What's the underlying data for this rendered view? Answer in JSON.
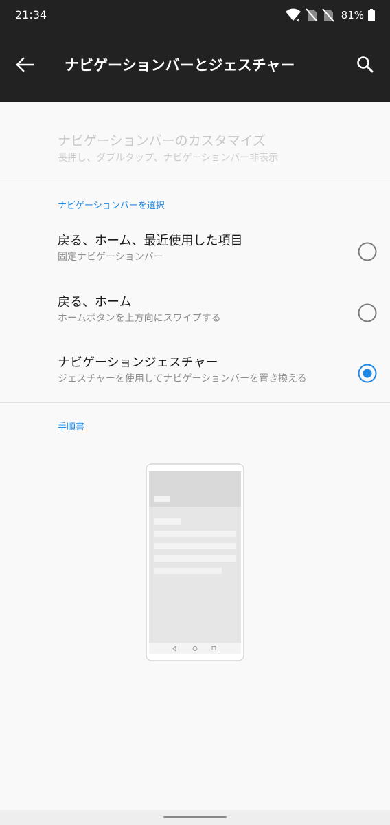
{
  "status_bar": {
    "time": "21:34",
    "battery_percent": "81%",
    "icons": [
      "wifi-icon",
      "no-sim-icon",
      "no-sim-icon",
      "battery-icon"
    ]
  },
  "app_bar": {
    "title": "ナビゲーションバーとジェスチャー",
    "back_icon": "arrow-left-icon",
    "search_icon": "search-icon"
  },
  "customize": {
    "title": "ナビゲーションバーのカスタマイズ",
    "subtitle": "長押し、ダブルタップ、ナビゲーションバー非表示",
    "enabled": false
  },
  "navbar_section": {
    "header": "ナビゲーションバーを選択",
    "options": [
      {
        "title": "戻る、ホーム、最近使用した項目",
        "subtitle": "固定ナビゲーションバー",
        "selected": false
      },
      {
        "title": "戻る、ホーム",
        "subtitle": "ホームボタンを上方向にスワイプする",
        "selected": false
      },
      {
        "title": "ナビゲーションジェスチャー",
        "subtitle": "ジェスチャーを使用してナビゲーションバーを置き換える",
        "selected": true
      }
    ]
  },
  "instructions_section": {
    "header": "手順書"
  },
  "colors": {
    "app_bar_bg": "#222222",
    "accent": "#1e88e5",
    "background": "#f9f9f9",
    "disabled_text": "#c8c8c8",
    "primary_text": "#1b1b1b",
    "secondary_text": "#8f8f8f"
  }
}
